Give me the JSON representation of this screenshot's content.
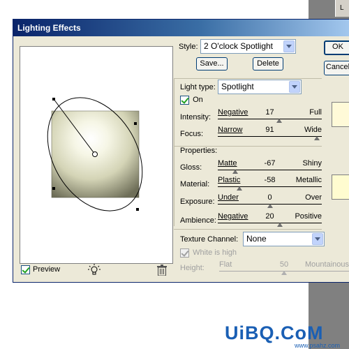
{
  "window": {
    "title": "Lighting Effects"
  },
  "background": {
    "panel_letter": "L"
  },
  "style": {
    "label": "Style:",
    "value": "2 O'clock Spotlight"
  },
  "buttons": {
    "ok": "OK",
    "cancel": "Cancel",
    "save": "Save...",
    "delete": "Delete"
  },
  "light": {
    "type_label": "Light type:",
    "type_value": "Spotlight",
    "on_label": "On",
    "on_checked": true,
    "intensity": {
      "label": "Intensity:",
      "left": "Negative",
      "right": "Full",
      "value": "17",
      "fraction": 0.59
    },
    "focus": {
      "label": "Focus:",
      "left": "Narrow",
      "right": "Wide",
      "value": "91",
      "fraction": 0.955
    },
    "color": "#fffad8"
  },
  "properties": {
    "heading": "Properties:",
    "gloss": {
      "label": "Gloss:",
      "left": "Matte",
      "right": "Shiny",
      "value": "-67",
      "fraction": 0.165
    },
    "material": {
      "label": "Material:",
      "left": "Plastic",
      "right": "Metallic",
      "value": "-58",
      "fraction": 0.21
    },
    "exposure": {
      "label": "Exposure:",
      "left": "Under",
      "right": "Over",
      "value": "0",
      "fraction": 0.5
    },
    "ambience": {
      "label": "Ambience:",
      "left": "Negative",
      "right": "Positive",
      "value": "20",
      "fraction": 0.6
    },
    "color": "#fffcd0"
  },
  "texture": {
    "channel_label": "Texture Channel:",
    "channel_value": "None",
    "white_is_high_label": "White is high",
    "white_is_high_checked": true,
    "height": {
      "label": "Height:",
      "left": "Flat",
      "right": "Mountainous",
      "value": "50",
      "fraction": 0.5
    }
  },
  "preview": {
    "label": "Preview",
    "checked": true
  },
  "icons": {
    "light_bulb": "light-bulb-icon",
    "trash": "trash-icon"
  },
  "watermark": {
    "main": "UiBQ.CoM",
    "sub": "www.psahz.com"
  }
}
